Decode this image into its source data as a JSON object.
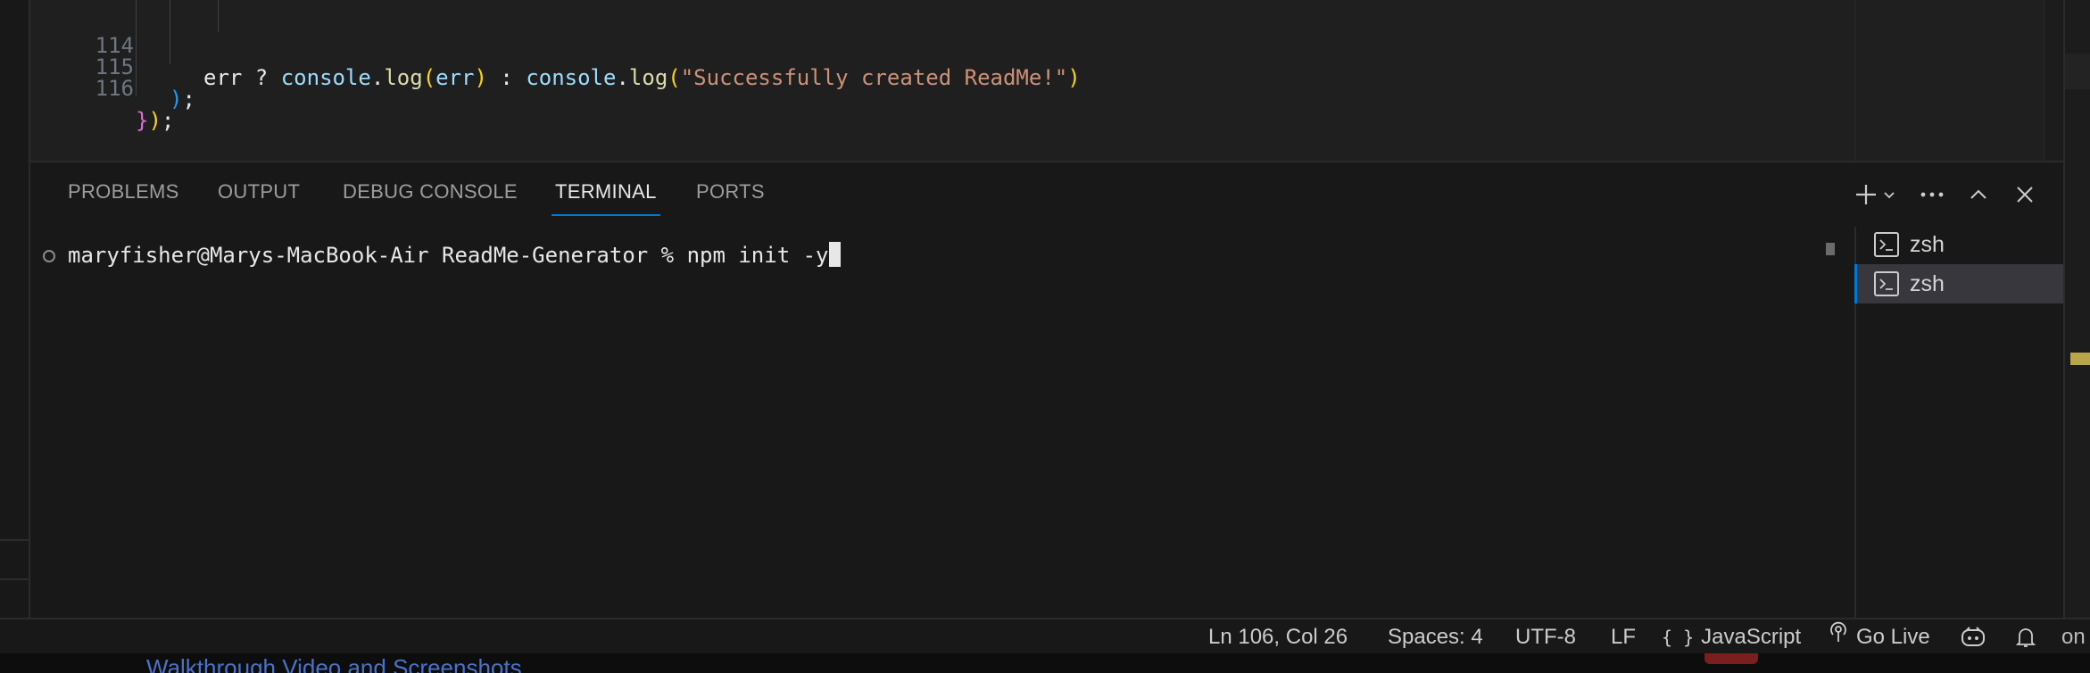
{
  "editor": {
    "lines": [
      {
        "num": "114",
        "tokens": [
          {
            "t": "err",
            "c": "#e7e7e7"
          },
          {
            "t": " ? ",
            "c": "#e7e7e7"
          },
          {
            "t": "console",
            "c": "#9cdcfe"
          },
          {
            "t": ".",
            "c": "#e7e7e7"
          },
          {
            "t": "log",
            "c": "#dcdcaa"
          },
          {
            "t": "(",
            "c": "#ffd700"
          },
          {
            "t": "err",
            "c": "#9cdcfe"
          },
          {
            "t": ")",
            "c": "#ffd700"
          },
          {
            "t": " : ",
            "c": "#e7e7e7"
          },
          {
            "t": "console",
            "c": "#9cdcfe"
          },
          {
            "t": ".",
            "c": "#e7e7e7"
          },
          {
            "t": "log",
            "c": "#dcdcaa"
          },
          {
            "t": "(",
            "c": "#ffd700"
          },
          {
            "t": "\"Successfully created ReadMe!\"",
            "c": "#ce9178"
          },
          {
            "t": ")",
            "c": "#ffd700"
          }
        ]
      },
      {
        "num": "115",
        "tokens": [
          {
            "t": ")",
            "c": "#179fff"
          },
          {
            "t": ";",
            "c": "#e7e7e7"
          }
        ]
      },
      {
        "num": "116",
        "tokens": [
          {
            "t": "}",
            "c": "#da70d6"
          },
          {
            "t": ")",
            "c": "#ffd700"
          },
          {
            "t": ";",
            "c": "#e7e7e7"
          }
        ]
      }
    ]
  },
  "panel": {
    "tabs": [
      "PROBLEMS",
      "OUTPUT",
      "DEBUG CONSOLE",
      "TERMINAL",
      "PORTS"
    ],
    "active_tab": "TERMINAL",
    "actions": [
      "plus-icon",
      "chevron-down-icon",
      "more-icon",
      "chevron-up-icon",
      "close-icon"
    ]
  },
  "terminal": {
    "prompt": "maryfisher@Marys-MacBook-Air ReadMe-Generator % npm init -y",
    "sessions": [
      {
        "label": "zsh",
        "active": false
      },
      {
        "label": "zsh",
        "active": true
      }
    ]
  },
  "status_bar": {
    "position": "Ln 106, Col 26",
    "spaces": "Spaces: 4",
    "encoding": "UTF-8",
    "eol": "LF",
    "language_icon": "{ }",
    "language": "JavaScript",
    "go_live": "Go Live",
    "overflow_text": "on"
  },
  "below": {
    "peek_text": "Walkthrough Video and Screenshots"
  },
  "colors": {
    "accent": "#0078d4",
    "panel_bg": "#181818",
    "editor_bg": "#1f1f1f"
  }
}
